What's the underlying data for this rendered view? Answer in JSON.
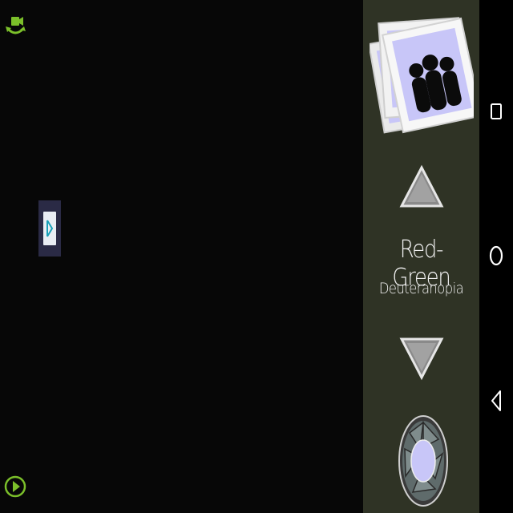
{
  "app": {
    "mode_title": "Red-Green",
    "mode_subtitle": "Deuteranopia"
  },
  "colors": {
    "panel_bg": "#2f3325",
    "accent_green": "#7bbf2a",
    "photo_lavender": "#c8c6f8",
    "preview_bg": "#070707"
  },
  "icons": {
    "switch_camera": "switch-camera-icon",
    "play": "play-icon",
    "gallery": "photo-gallery-icon",
    "up": "triangle-up-icon",
    "down": "triangle-down-icon",
    "shutter": "camera-shutter-icon",
    "recent_apps": "square-icon",
    "home": "circle-icon",
    "back": "triangle-back-icon"
  }
}
